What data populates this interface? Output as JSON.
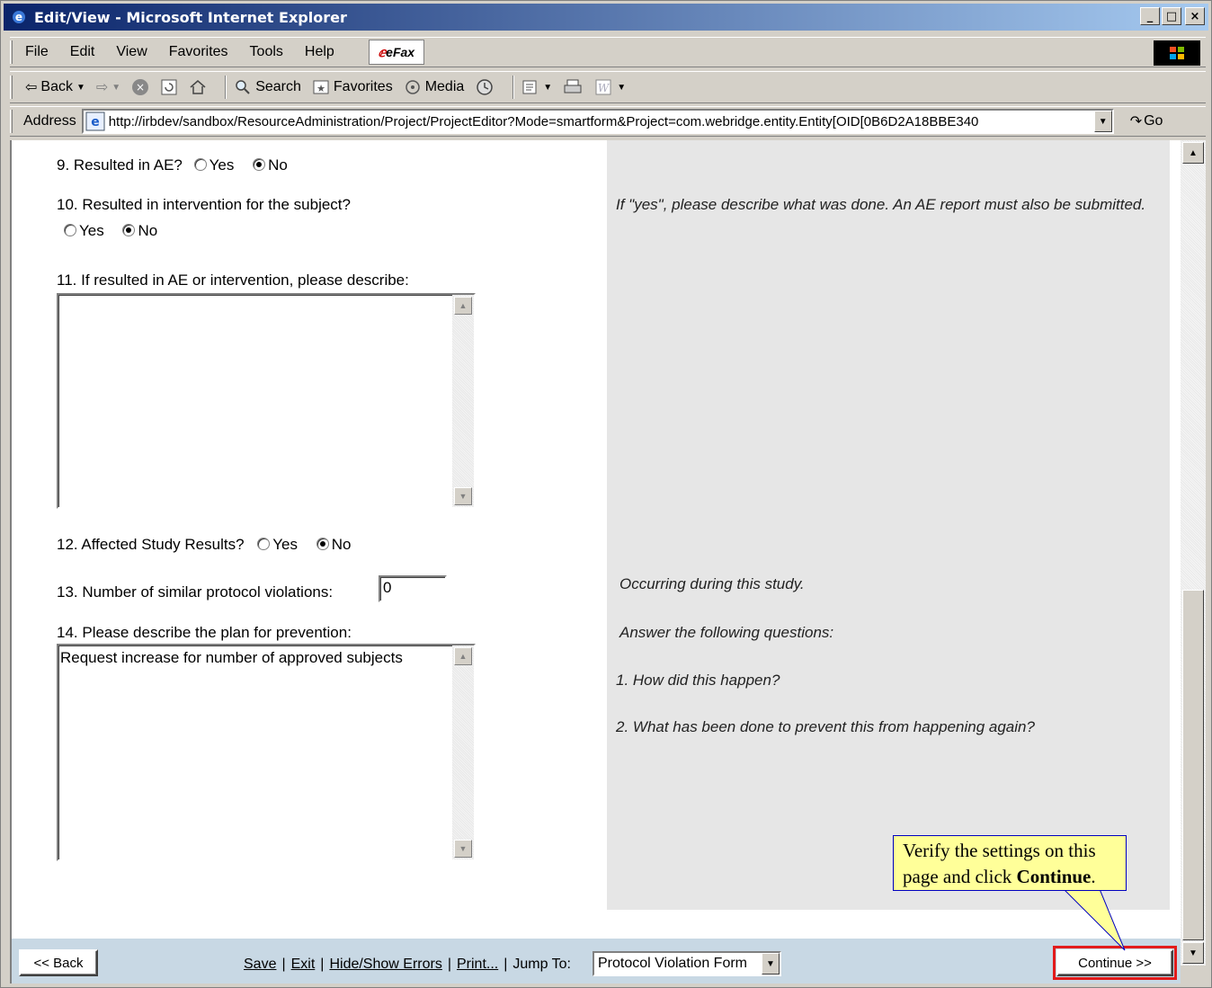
{
  "window": {
    "title": "Edit/View - Microsoft Internet Explorer",
    "controls": [
      "_",
      "□",
      "×"
    ]
  },
  "menubar": {
    "items": [
      "File",
      "Edit",
      "View",
      "Favorites",
      "Tools",
      "Help"
    ],
    "efax": "eFax"
  },
  "toolbar": {
    "back": "Back",
    "search": "Search",
    "favorites": "Favorites",
    "media": "Media"
  },
  "address": {
    "label": "Address",
    "url": "http://irbdev/sandbox/ResourceAdministration/Project/ProjectEditor?Mode=smartform&Project=com.webridge.entity.Entity[OID[0B6D2A18BBE340",
    "go": "Go"
  },
  "form": {
    "q9": {
      "label": "9.  Resulted in AE?",
      "yes": "Yes",
      "no": "No",
      "selected": "No"
    },
    "q10": {
      "label": "10.  Resulted in intervention for the subject?",
      "yes": "Yes",
      "no": "No",
      "selected": "No"
    },
    "q11": {
      "label": "11.  If resulted in AE or intervention, please describe:",
      "value": ""
    },
    "q12": {
      "label": "12.  Affected Study Results?",
      "yes": "Yes",
      "no": "No",
      "selected": "No"
    },
    "q13": {
      "label": "13.  Number of similar protocol violations:",
      "value": "0"
    },
    "q14": {
      "label": "14.  Please describe the plan for prevention:",
      "value": "Request increase for number of approved subjects"
    }
  },
  "help": {
    "q10_help": "If \"yes\", please describe what was done.  An AE report must also be submitted.",
    "q13_help": "Occurring during this study.",
    "q14_help_intro": "Answer the following questions:",
    "q14_help_1": "1. How did this happen?",
    "q14_help_2": "2. What has been done to prevent this from happening again?"
  },
  "nav": {
    "back": "<< Back",
    "save": "Save",
    "exit": "Exit",
    "hide_show_errors": "Hide/Show Errors",
    "print": "Print...",
    "jump_to_label": "Jump To:",
    "jump_to_value": "Protocol Violation Form",
    "continue": "Continue >>"
  },
  "callout": {
    "text_before": "Verify the settings on this page and click ",
    "text_bold": "Continue",
    "text_after": "."
  },
  "colors": {
    "title_gradient_start": "#0a246a",
    "highlight": "#e21b1b",
    "callout_bg": "#ffff99",
    "nav_bg": "#c8d8e4",
    "help_bg": "#e6e6e6"
  }
}
